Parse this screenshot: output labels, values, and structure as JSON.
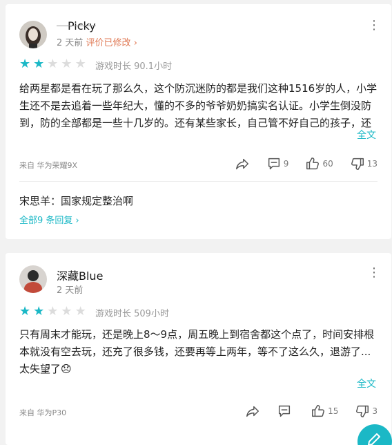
{
  "reviews": [
    {
      "username": " Picky",
      "time": "2 天前",
      "edited": "评价已修改",
      "stars_filled": 2,
      "stars_total": 5,
      "playtime": "游戏时长 90.1小时",
      "body": "给两星都是看在玩了那么久，这个防沉迷防的都是我们这种1516岁的人，小学生还不是去追着一些年纪大，懂的不多的爷爷奶奶搞实名认证。小学生倒没防到，防的全部都是一些十几岁的。还有某些家长，自己管不好自己的孩子，还各种作妖，无语死了。而且我在期末考试前都还在这玩",
      "fulltext": "全文",
      "device": "来自 华为荣耀9X",
      "comments": "9",
      "likes": "60",
      "dislikes": "13",
      "reply": {
        "author": "宋思羊",
        "sep": "：",
        "text": "国家规定整治啊"
      },
      "all_replies": "全部9 条回复"
    },
    {
      "username": "深藏Blue",
      "time": "2 天前",
      "stars_filled": 2,
      "stars_total": 5,
      "playtime": "游戏时长 509小时",
      "body": "只有周末才能玩，还是晚上8～9点，周五晚上到宿舍都这个点了，时间安排根本就没有空去玩，还充了很多钱，还要再等上两年，等不了这么久，退游了...太失望了😞",
      "fulltext": "全文",
      "device": "来自 华为P30",
      "comments": "",
      "likes": "15",
      "dislikes": "3"
    }
  ],
  "icons": {
    "share": "share-icon",
    "comment": "comment-icon",
    "like": "thumbs-up-icon",
    "dislike": "thumbs-down-icon",
    "more": "more-vertical-icon",
    "fab": "pencil-icon"
  },
  "colors": {
    "accent": "#1bb8c6",
    "edited": "#e07a56",
    "star_off": "#dcdcdc"
  }
}
